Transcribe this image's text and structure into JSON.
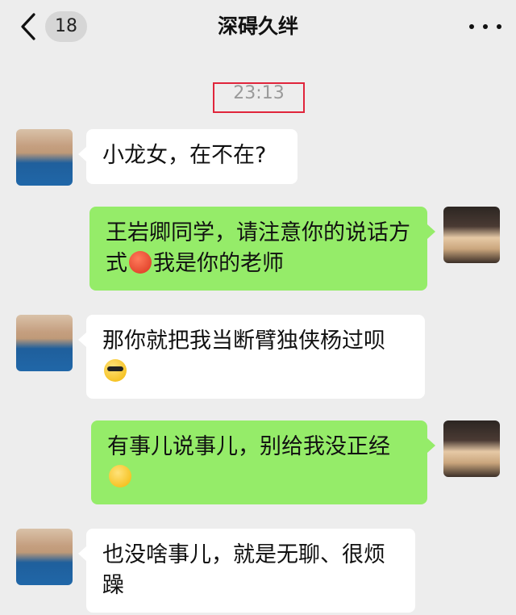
{
  "header": {
    "back_icon": "chevron-left-icon",
    "unread_count": "18",
    "title": "深碍久绊",
    "more_icon": "more-dots-icon"
  },
  "timestamp": "23:13",
  "messages": [
    {
      "side": "in",
      "text": "小龙女，在不在?"
    },
    {
      "side": "out",
      "text_before": "王岩卿同学，请注意你的说话方式",
      "emoji": "angry-face-emoji",
      "text_after": "我是你的老师"
    },
    {
      "side": "in",
      "text": "那你就把我当断臂独侠杨过呗",
      "emoji": "sunglasses-face-emoji"
    },
    {
      "side": "out",
      "text": "有事儿说事儿，别给我没正经",
      "emoji": "thinking-face-emoji"
    },
    {
      "side": "in",
      "text": "也没啥事儿，就是无聊、很烦躁"
    }
  ],
  "colors": {
    "background": "#ededed",
    "incoming_bubble": "#ffffff",
    "outgoing_bubble": "#95ec69",
    "highlight_box": "#e0253b"
  }
}
